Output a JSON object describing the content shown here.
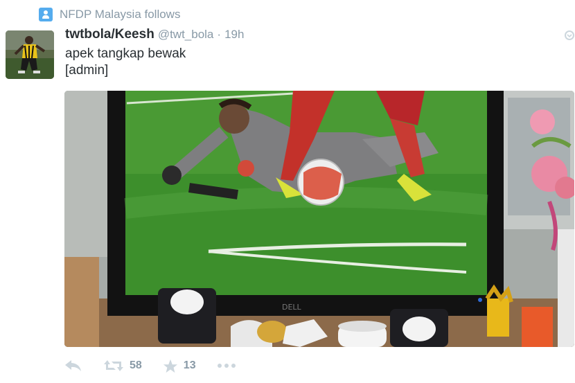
{
  "context": {
    "icon": "person-icon",
    "text": "NFDP Malaysia follows"
  },
  "tweet": {
    "author_name": "twtbola/Keesh",
    "author_handle": "@twt_bola",
    "separator": "·",
    "timestamp": "19h",
    "text_lines": [
      "apek tangkap bewak",
      "[admin]"
    ],
    "monitor_brand": "DELL"
  },
  "actions": {
    "reply": {
      "icon": "reply-icon"
    },
    "retweet": {
      "icon": "retweet-icon",
      "count": "58"
    },
    "favorite": {
      "icon": "star-icon",
      "count": "13"
    },
    "more": {
      "icon": "more-icon"
    }
  },
  "colors": {
    "accent": "#55acee",
    "muted": "#8899a6",
    "text": "#292f33",
    "action_icon": "#ccd6dd"
  }
}
